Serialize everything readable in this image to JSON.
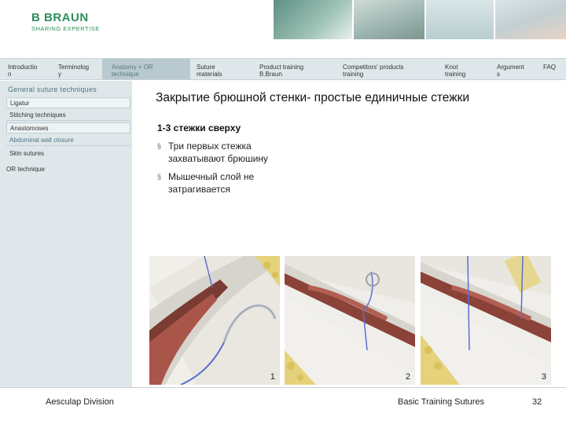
{
  "header": {
    "logo_name": "B BRAUN",
    "logo_tagline": "SHARING EXPERTISE"
  },
  "nav": [
    "Introductio\nn",
    "Terminolog\ny",
    "Anatomy + OR\ntechnique",
    "Suture\nmaterials",
    "Product training\nB.Braun",
    "Competitors' products\ntraining",
    "Knot\ntraining",
    "Argument\ns",
    "FAQ"
  ],
  "sidebar": {
    "heading": "General suture techniques",
    "items": [
      "Ligatur",
      "Stitching techniques",
      "Anastomoses",
      "Abdominal wall closure",
      "Skin sutures",
      "OR technique"
    ]
  },
  "main": {
    "title": "Закрытие брюшной стенки- простые единичные стежки",
    "subheading": "1-3 стежки сверху",
    "bullets": [
      "Три первых стежка захватывают брюшину",
      "Мышечный слой не затрагивается"
    ],
    "bullet_marker": "§",
    "image_labels": [
      "1",
      "2",
      "3"
    ]
  },
  "footer": {
    "division": "Aesculap Division",
    "course": "Basic Training Sutures",
    "page": "32"
  },
  "colors": {
    "brand_green": "#2e8f5b",
    "nav_bg": "#dfe7eb",
    "active_tab": "#b8c9cf",
    "accent_text": "#4f7480"
  }
}
